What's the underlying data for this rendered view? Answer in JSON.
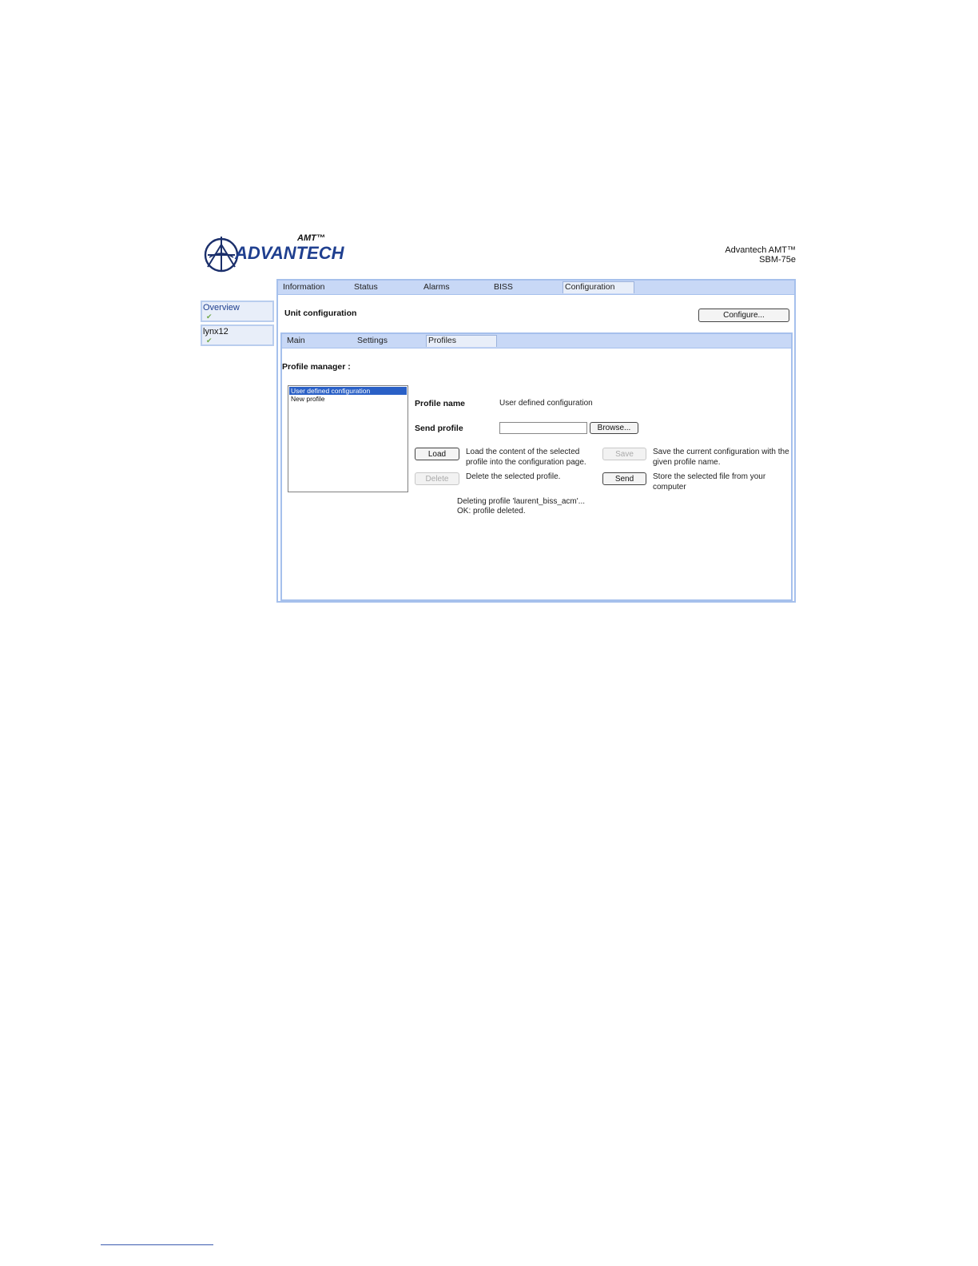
{
  "header": {
    "logo_text": "ADVANTECH",
    "logo_superscript": "AMT™",
    "product_line1": "Advantech AMT™",
    "product_line2": "SBM-75e"
  },
  "sidebar": {
    "items": [
      {
        "label": "Overview",
        "status_icon": "check-icon"
      },
      {
        "label": "lynx12",
        "status_icon": "check-icon"
      }
    ]
  },
  "tabs": [
    "Information",
    "Status",
    "Alarms",
    "BISS",
    "Configuration"
  ],
  "active_tab": "Configuration",
  "unit_config": {
    "title": "Unit configuration",
    "configure_button": "Configure..."
  },
  "subtabs": [
    "Main",
    "Settings",
    "Profiles"
  ],
  "active_subtab": "Profiles",
  "profile_manager": {
    "title": "Profile manager :",
    "profiles": [
      "User defined configuration",
      "New profile"
    ],
    "selected_profile": "User defined configuration",
    "profile_name_label": "Profile name",
    "profile_name_value": "User defined configuration",
    "send_profile_label": "Send profile",
    "browse_button": "Browse...",
    "load_button": "Load",
    "load_desc_line1": "Load the content of the selected",
    "load_desc_line2": "profile into the configuration page.",
    "delete_button": "Delete",
    "delete_desc": "Delete the selected profile.",
    "save_button": "Save",
    "save_desc_line1": "Save the current configuration with the",
    "save_desc_line2": "given profile name.",
    "send_button": "Send",
    "send_desc_line1": "Store the selected file from your",
    "send_desc_line2": "computer",
    "status_line1": "Deleting profile 'laurent_biss_acm'...",
    "status_line2": "OK: profile deleted."
  }
}
